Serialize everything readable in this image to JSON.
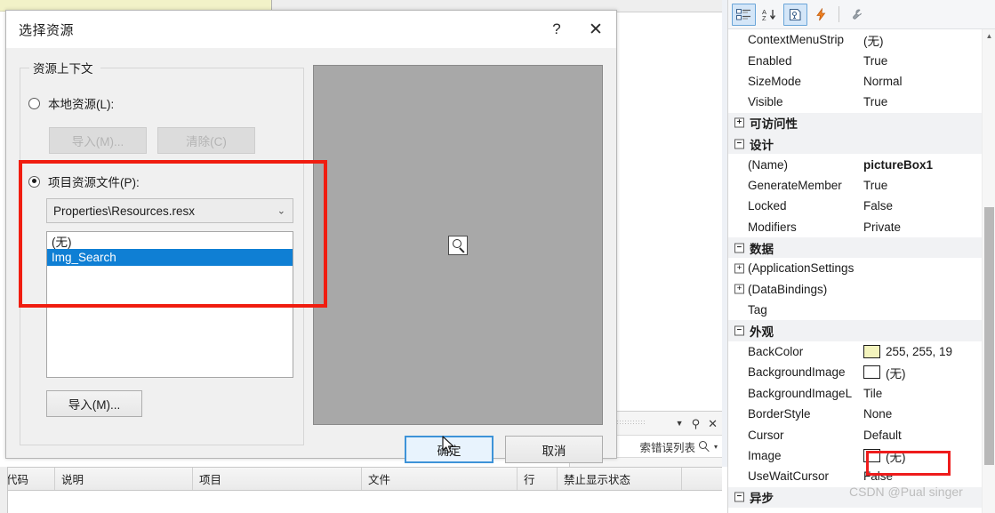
{
  "dialog": {
    "title": "选择资源",
    "help_label": "?",
    "close_label": "✕",
    "groupbox_legend": "资源上下文",
    "local_resource_label": "本地资源(L):",
    "local_import_label": "导入(M)...",
    "local_clear_label": "清除(C)",
    "project_resource_label": "项目资源文件(P):",
    "resource_file_value": "Properties\\Resources.resx",
    "resource_file_arrow": "⌄",
    "resource_items": [
      {
        "label": "(无)",
        "selected": false
      },
      {
        "label": "Img_Search",
        "selected": true
      }
    ],
    "project_import_label": "导入(M)...",
    "ok_label": "确定",
    "cancel_label": "取消",
    "preview_icon": "image-placeholder-magnifier-icon"
  },
  "properties_panel": {
    "toolbar": [
      {
        "name": "categorized-view-icon",
        "active": true
      },
      {
        "name": "alphabetical-sort-icon",
        "active": false
      },
      {
        "name": "properties-page-icon",
        "active": true
      },
      {
        "name": "events-lightning-icon",
        "active": false
      },
      {
        "name": "property-pages-wrench-icon",
        "active": false
      }
    ],
    "rows": [
      {
        "type": "prop",
        "name": "ContextMenuStrip",
        "value": "(无)",
        "bold": false
      },
      {
        "type": "prop",
        "name": "Enabled",
        "value": "True",
        "bold": false
      },
      {
        "type": "prop",
        "name": "SizeMode",
        "value": "Normal",
        "bold": false
      },
      {
        "type": "prop",
        "name": "Visible",
        "value": "True",
        "bold": false
      },
      {
        "type": "cat",
        "name": "可访问性",
        "expander": "+"
      },
      {
        "type": "cat",
        "name": "设计",
        "expander": "−"
      },
      {
        "type": "prop",
        "name": "(Name)",
        "value": "pictureBox1",
        "bold": true
      },
      {
        "type": "prop",
        "name": "GenerateMember",
        "value": "True",
        "bold": false
      },
      {
        "type": "prop",
        "name": "Locked",
        "value": "False",
        "bold": false
      },
      {
        "type": "prop",
        "name": "Modifiers",
        "value": "Private",
        "bold": false
      },
      {
        "type": "cat",
        "name": "数据",
        "expander": "−"
      },
      {
        "type": "prop",
        "name": "(ApplicationSettings",
        "value": "",
        "bold": false,
        "expander": "+"
      },
      {
        "type": "prop",
        "name": "(DataBindings)",
        "value": "",
        "bold": false,
        "expander": "+"
      },
      {
        "type": "prop",
        "name": "Tag",
        "value": "",
        "bold": false
      },
      {
        "type": "cat",
        "name": "外观",
        "expander": "−"
      },
      {
        "type": "prop",
        "name": "BackColor",
        "value": "255, 255, 19",
        "bold": false,
        "swatch": "#f4f4bd"
      },
      {
        "type": "prop",
        "name": "BackgroundImage",
        "value": "(无)",
        "bold": false,
        "swatch": "#ffffff"
      },
      {
        "type": "prop",
        "name": "BackgroundImageL",
        "value": "Tile",
        "bold": false
      },
      {
        "type": "prop",
        "name": "BorderStyle",
        "value": "None",
        "bold": false
      },
      {
        "type": "prop",
        "name": "Cursor",
        "value": "Default",
        "bold": false
      },
      {
        "type": "prop",
        "name": "Image",
        "value": "(无)",
        "bold": false,
        "swatch": "#ffffff"
      },
      {
        "type": "prop",
        "name": "UseWaitCursor",
        "value": "False",
        "bold": false
      },
      {
        "type": "cat",
        "name": "异步",
        "expander": "−"
      }
    ]
  },
  "error_list": {
    "dropdown_label": "▼",
    "pin_label": "⚲",
    "close_label": "✕",
    "search_label": "索错误列表",
    "search_icon": "magnifier-icon",
    "columns": [
      "代码",
      "说明",
      "项目",
      "文件",
      "行",
      "禁止显示状态"
    ]
  },
  "watermark": "CSDN @Pual singer",
  "colors": {
    "annotation_red": "#f01d10",
    "selection_blue": "#0f7fd4",
    "primary_border": "#3e93d8",
    "form_yellow": "#f2f2c8",
    "preview_gray": "#a8a8a8"
  }
}
